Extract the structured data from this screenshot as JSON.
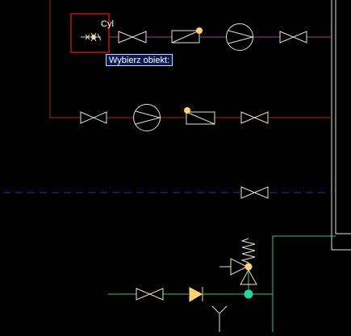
{
  "prompt": {
    "tooltip_text": "Wybierz obiekt:",
    "cursor_label": "Cyl"
  },
  "colors": {
    "background": "#000000",
    "red_line": "#b22323",
    "magenta_line": "#b02bb0",
    "blue_dashed_line": "#1a33c8",
    "green_line": "#3fbf7f",
    "symbol_stroke": "#e8e3c8",
    "yellow_fill": "#ffd36e",
    "cyan_node": "#1fd6a5",
    "selection_box": "#8a1010",
    "right_frame": "#e8e3c8"
  },
  "icons": [
    "gate-valve-icon",
    "pump-icon",
    "flow-meter-icon",
    "check-valve-icon",
    "safety-valve-icon",
    "spring-icon",
    "drain-funnel-icon",
    "crosshair-cursor-icon"
  ]
}
